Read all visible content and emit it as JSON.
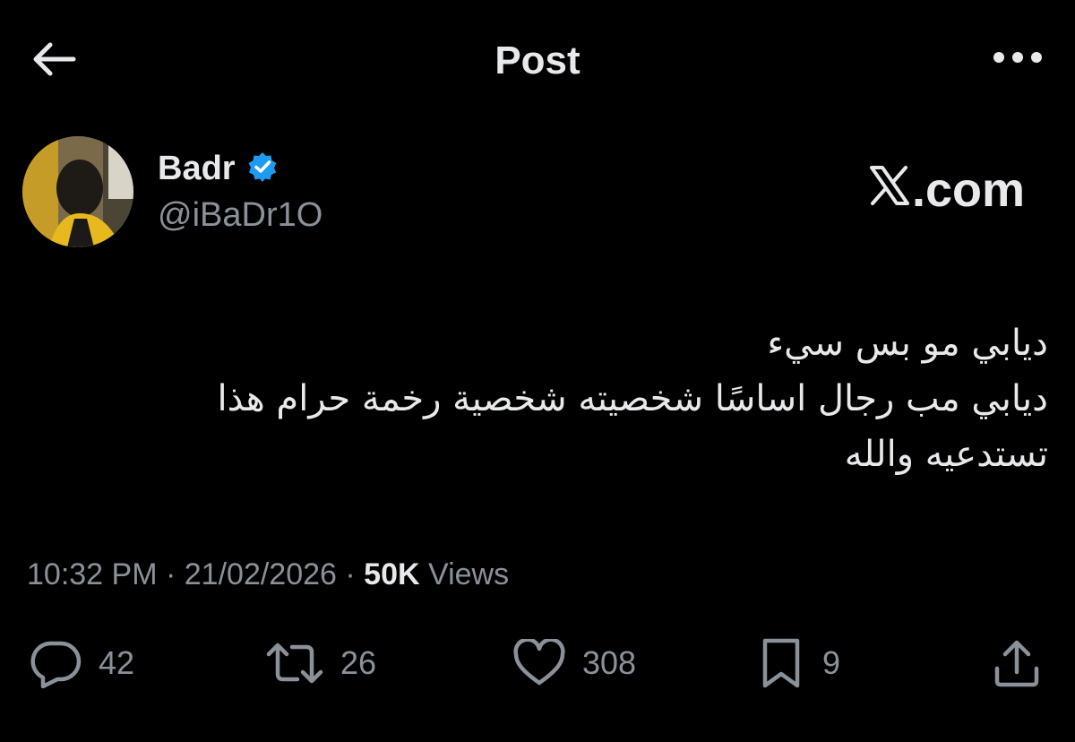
{
  "header": {
    "title": "Post",
    "back_icon": "arrow-left-icon",
    "more_icon": "more-horizontal-icon"
  },
  "author": {
    "name": "Badr",
    "handle": "@iBaDr1O",
    "verified_icon": "verified-badge-icon",
    "verified_color": "#1d9bf0"
  },
  "watermark": {
    "logo_text": "X",
    "domain_suffix": ".com"
  },
  "post": {
    "lines": [
      "ديابي مو بس سيء",
      "ديابي مب رجال اساسًا شخصيته شخصية رخمة حرام هذا",
      "تستدعيه والله"
    ]
  },
  "meta": {
    "time": "10:32 PM",
    "separator": "·",
    "date": "21/02/2026",
    "views_count": "50K",
    "views_label": "Views"
  },
  "actions": {
    "replies": "42",
    "reposts": "26",
    "likes": "308",
    "bookmarks": "9"
  },
  "colors": {
    "background": "#000000",
    "text_primary": "#e7e9ea",
    "text_secondary": "#8b9198",
    "accent": "#1d9bf0"
  }
}
